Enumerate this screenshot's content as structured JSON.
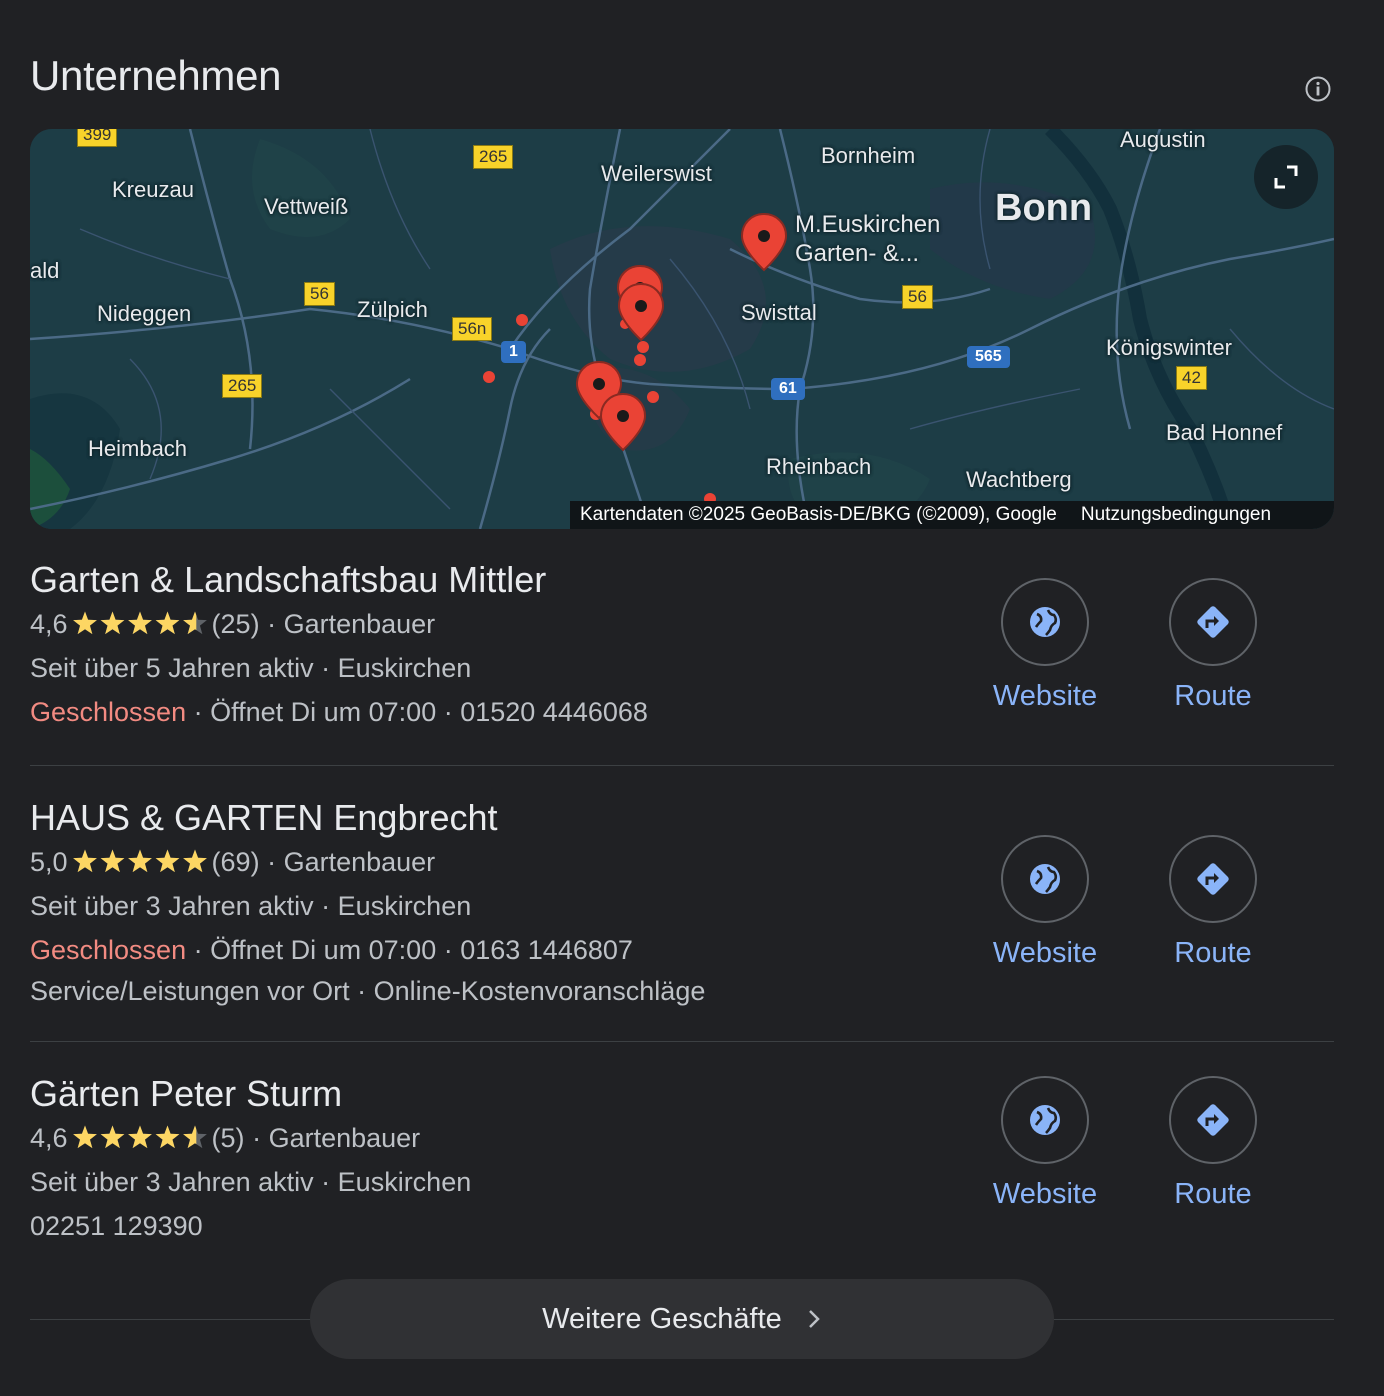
{
  "header": {
    "title": "Unternehmen"
  },
  "map": {
    "places": {
      "kreuzau": "Kreuzau",
      "vettweiss": "Vettweiß",
      "weilerswist": "Weilerswist",
      "bornheim": "Bornheim",
      "augustin": "Augustin",
      "bonn": "Bonn",
      "ald": "ald",
      "nideggen": "Nideggen",
      "zuelpich": "Zülpich",
      "swisttal": "Swisttal",
      "koenigswinter": "Königswinter",
      "heimbach": "Heimbach",
      "rheinbach": "Rheinbach",
      "wachtberg": "Wachtberg",
      "bad_honnef": "Bad Honnef"
    },
    "pin_label_line1": "M.Euskirchen",
    "pin_label_line2": "Garten- &...",
    "roads": {
      "r399": "399",
      "r265a": "265",
      "r56a": "56",
      "r56n": "56n",
      "r1": "1",
      "r265b": "265",
      "r56b": "56",
      "r565": "565",
      "r61": "61",
      "r42": "42"
    },
    "attribution": "Kartendaten ©2025 GeoBasis-DE/BKG (©2009), Google",
    "terms": "Nutzungsbedingungen"
  },
  "listings": [
    {
      "name": "Garten & Landschaftsbau Mittler",
      "rating": "4,6",
      "stars": 4.6,
      "reviews": "(25)",
      "category": "Gartenbauer",
      "years": "Seit über 5 Jahren aktiv",
      "city": "Euskirchen",
      "status": "Geschlossen",
      "opens": "Öffnet Di um 07:00",
      "phone": "01520 4446068",
      "website_label": "Website",
      "route_label": "Route"
    },
    {
      "name": "HAUS & GARTEN Engbrecht",
      "rating": "5,0",
      "stars": 5.0,
      "reviews": "(69)",
      "category": "Gartenbauer",
      "years": "Seit über 3 Jahren aktiv",
      "city": "Euskirchen",
      "status": "Geschlossen",
      "opens": "Öffnet Di um 07:00",
      "phone": "0163 1446807",
      "services": "Service/Leistungen vor Ort",
      "estimates": "Online-Kostenvoranschläge",
      "website_label": "Website",
      "route_label": "Route"
    },
    {
      "name": "Gärten Peter Sturm",
      "rating": "4,6",
      "stars": 4.6,
      "reviews": "(5)",
      "category": "Gartenbauer",
      "years": "Seit über 3 Jahren aktiv",
      "city": "Euskirchen",
      "phone": "02251 129390",
      "website_label": "Website",
      "route_label": "Route"
    }
  ],
  "more_button": {
    "label": "Weitere Geschäfte"
  },
  "colors": {
    "accent": "#8ab4f8",
    "closed": "#f28b82",
    "star": "#fdd663",
    "pin": "#ea4335"
  }
}
